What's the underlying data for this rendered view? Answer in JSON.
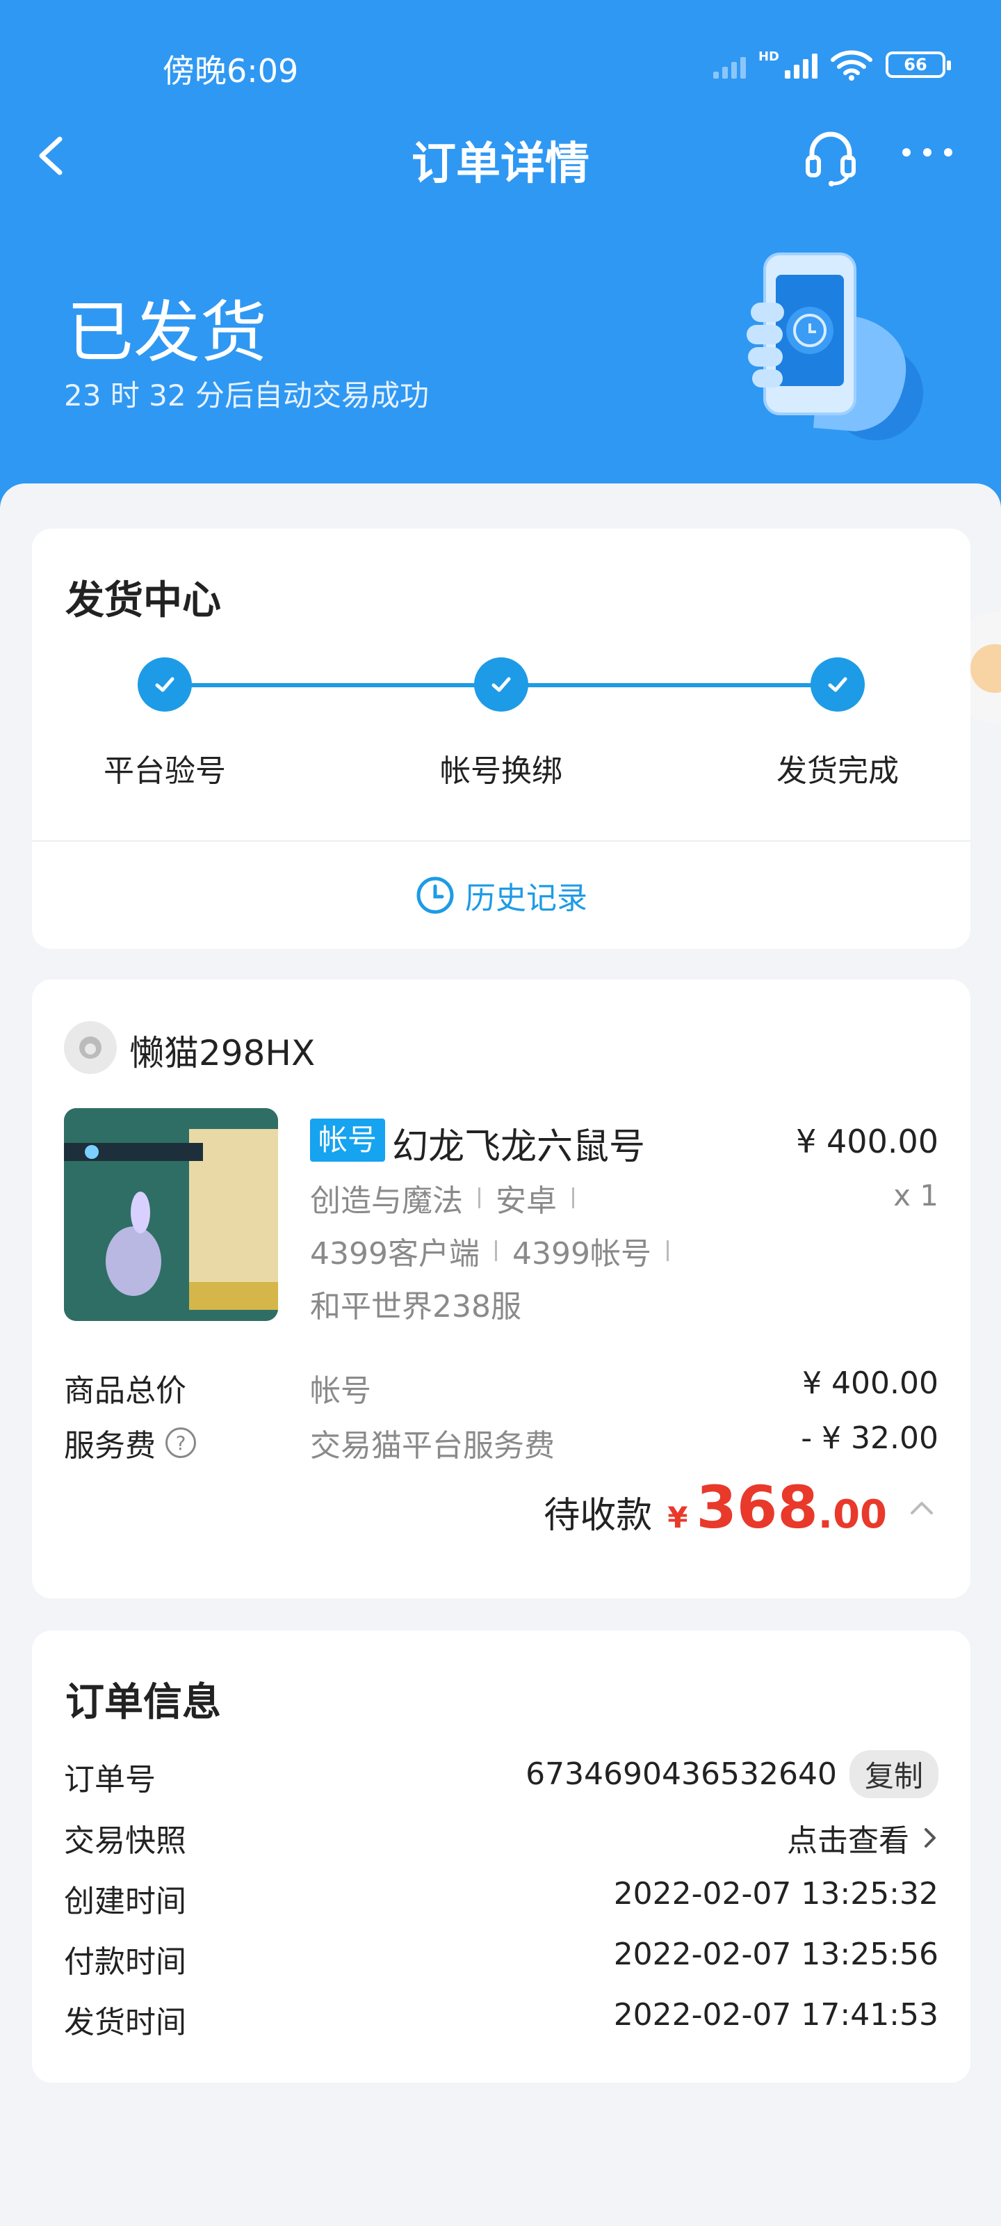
{
  "status_bar": {
    "time": "傍晚6:09",
    "hd": "HD",
    "battery": "66"
  },
  "nav": {
    "title": "订单详情"
  },
  "order_status": {
    "title": "已发货",
    "subtitle": "23 时 32 分后自动交易成功"
  },
  "shipping": {
    "title": "发货中心",
    "steps": [
      {
        "label": "平台验号"
      },
      {
        "label": "帐号换绑"
      },
      {
        "label": "发货完成"
      }
    ],
    "history_label": "历史记录",
    "accent": "#1d9be6"
  },
  "product": {
    "seller": "懒猫298HX",
    "tag": "帐号",
    "title": "幻龙飞龙六鼠号",
    "price": "¥ 400.00",
    "qty": "x 1",
    "attrs": [
      [
        "创造与魔法",
        "安卓"
      ],
      [
        "4399客户端",
        "4399帐号"
      ],
      [
        "和平世界238服"
      ]
    ],
    "fees": [
      {
        "label": "商品总价",
        "desc": "帐号",
        "value": "¥ 400.00"
      },
      {
        "label": "服务费",
        "desc": "交易猫平台服务费",
        "value": "- ¥ 32.00"
      }
    ],
    "total_label": "待收款",
    "total_currency": "¥",
    "total_int": "368",
    "total_dec": ".00",
    "total_color": "#e8392b"
  },
  "order_info": {
    "title": "订单信息",
    "rows": [
      {
        "label": "订单号",
        "value": "6734690436532640",
        "action": "复制"
      },
      {
        "label": "交易快照",
        "value": "点击查看"
      },
      {
        "label": "创建时间",
        "value": "2022-02-07 13:25:32"
      },
      {
        "label": "付款时间",
        "value": "2022-02-07 13:25:56"
      },
      {
        "label": "发货时间",
        "value": "2022-02-07 17:41:53"
      }
    ]
  },
  "theme": {
    "header_bg": "#2f98f3",
    "page_bg": "#f2f4f7"
  }
}
